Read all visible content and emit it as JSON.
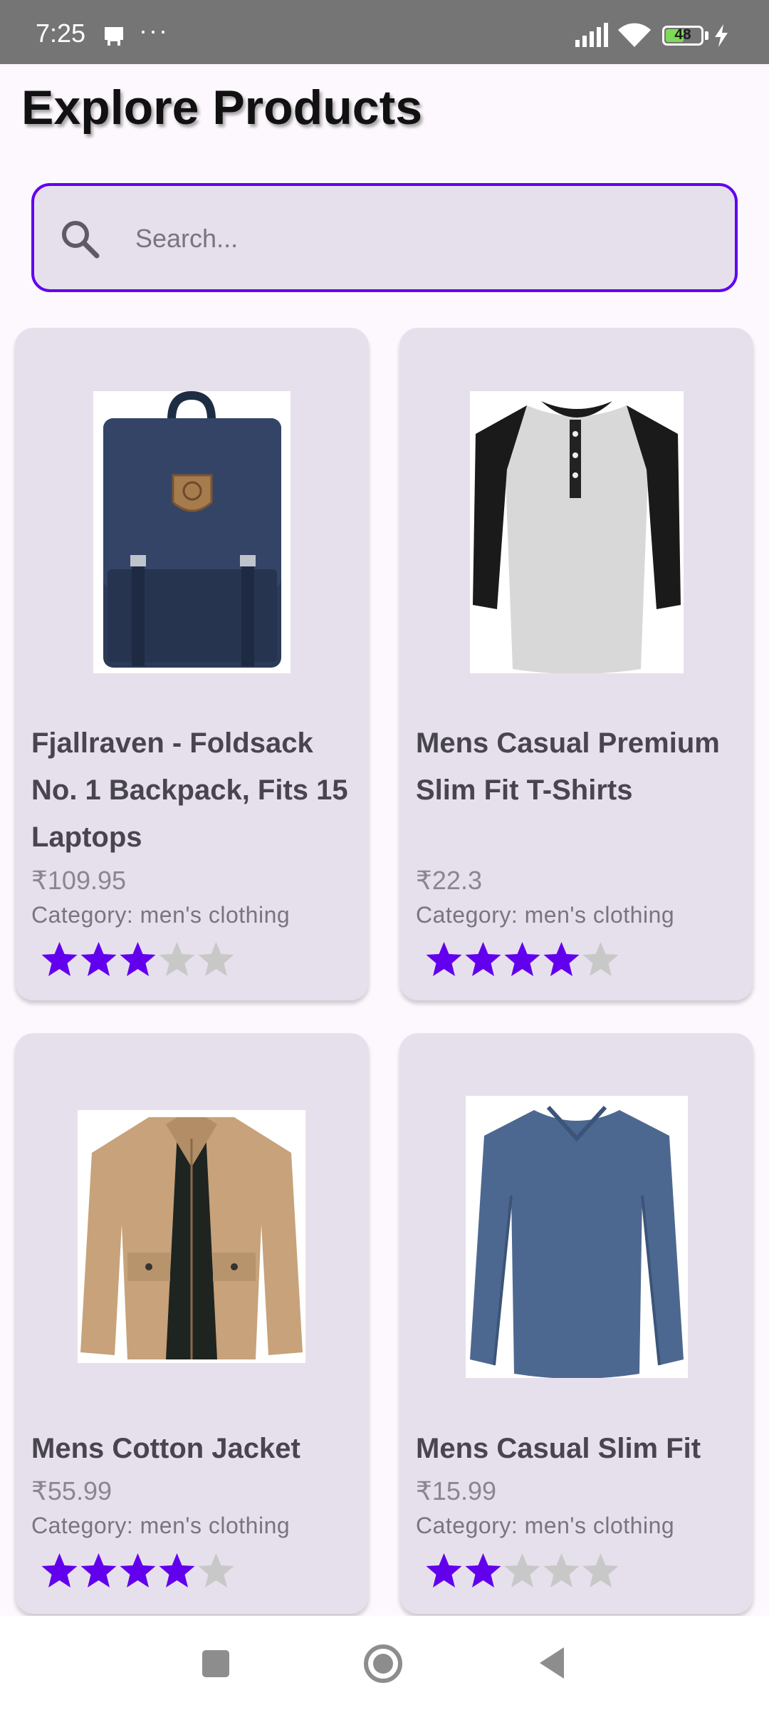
{
  "status_bar": {
    "time": "7:25",
    "dots": "···",
    "battery": "48",
    "icons": [
      "sd-card-icon",
      "signal-icon",
      "wifi-icon",
      "battery-icon",
      "charging-bolt-icon"
    ]
  },
  "header": {
    "title": "Explore Products"
  },
  "search": {
    "placeholder": "Search...",
    "value": ""
  },
  "colors": {
    "accent": "#6200ee",
    "card": "#e6e0ec",
    "star_empty": "#c8c8c8"
  },
  "products": [
    {
      "title": "Fjallraven - Foldsack No. 1 Backpack, Fits 15 Laptops",
      "price": "₹109.95",
      "category": "Category: men's clothing",
      "rating_stars": 3,
      "image": "backpack"
    },
    {
      "title": "Mens Casual Premium Slim Fit T-Shirts",
      "price": "₹22.3",
      "category": "Category: men's clothing",
      "rating_stars": 4,
      "image": "raglan-henley-tshirt"
    },
    {
      "title": "Mens Cotton Jacket",
      "price": "₹55.99",
      "category": "Category: men's clothing",
      "rating_stars": 4,
      "image": "cotton-jacket"
    },
    {
      "title": "Mens Casual Slim Fit",
      "price": "₹15.99",
      "category": "Category: men's clothing",
      "rating_stars": 2,
      "image": "long-sleeve-tshirt"
    }
  ],
  "nav": {
    "icons": [
      "recent-apps-icon",
      "home-icon",
      "back-icon"
    ]
  }
}
